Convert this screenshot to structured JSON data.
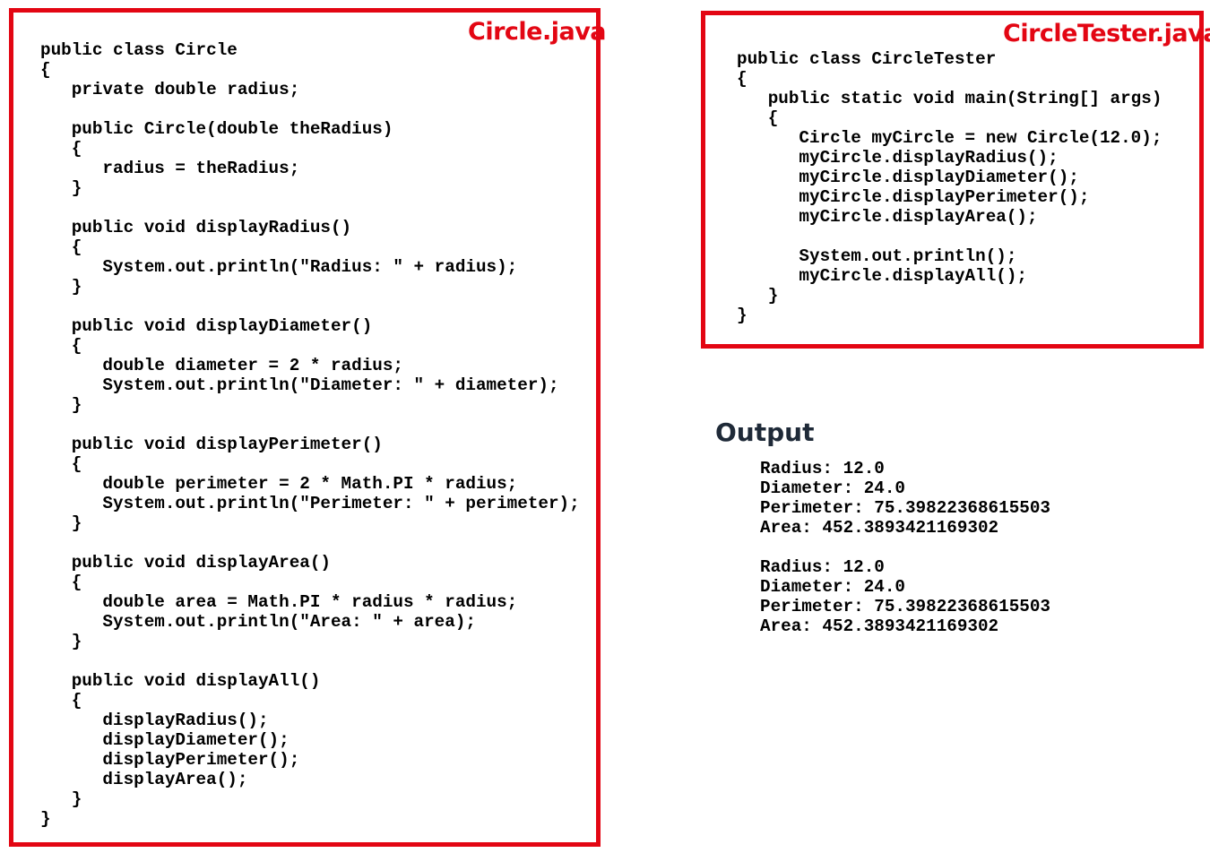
{
  "panels": {
    "circle": {
      "title": "Circle.java",
      "lines": [
        "public class Circle",
        "{",
        "   private double radius;",
        "",
        "   public Circle(double theRadius)",
        "   {",
        "      radius = theRadius;",
        "   }",
        "",
        "   public void displayRadius()",
        "   {",
        "      System.out.println(\"Radius: \" + radius);",
        "   }",
        "",
        "   public void displayDiameter()",
        "   {",
        "      double diameter = 2 * radius;",
        "      System.out.println(\"Diameter: \" + diameter);",
        "   }",
        "",
        "   public void displayPerimeter()",
        "   {",
        "      double perimeter = 2 * Math.PI * radius;",
        "      System.out.println(\"Perimeter: \" + perimeter);",
        "   }",
        "",
        "   public void displayArea()",
        "   {",
        "      double area = Math.PI * radius * radius;",
        "      System.out.println(\"Area: \" + area);",
        "   }",
        "",
        "   public void displayAll()",
        "   {",
        "      displayRadius();",
        "      displayDiameter();",
        "      displayPerimeter();",
        "      displayArea();",
        "   }",
        "}"
      ]
    },
    "tester": {
      "title": "CircleTester.java",
      "lines": [
        "public class CircleTester",
        "{",
        "   public static void main(String[] args)",
        "   {",
        "      Circle myCircle = new Circle(12.0);",
        "      myCircle.displayRadius();",
        "      myCircle.displayDiameter();",
        "      myCircle.displayPerimeter();",
        "      myCircle.displayArea();",
        "",
        "      System.out.println();",
        "      myCircle.displayAll();",
        "   }",
        "}"
      ]
    }
  },
  "output": {
    "title": "Output",
    "lines": [
      "Radius: 12.0",
      "Diameter: 24.0",
      "Perimeter: 75.39822368615503",
      "Area: 452.3893421169302",
      "",
      "Radius: 12.0",
      "Diameter: 24.0",
      "Perimeter: 75.39822368615503",
      "Area: 452.3893421169302"
    ]
  },
  "colors": {
    "accent": "#e30613",
    "heading": "#1f2a38",
    "code": "#000000",
    "background": "#ffffff"
  }
}
